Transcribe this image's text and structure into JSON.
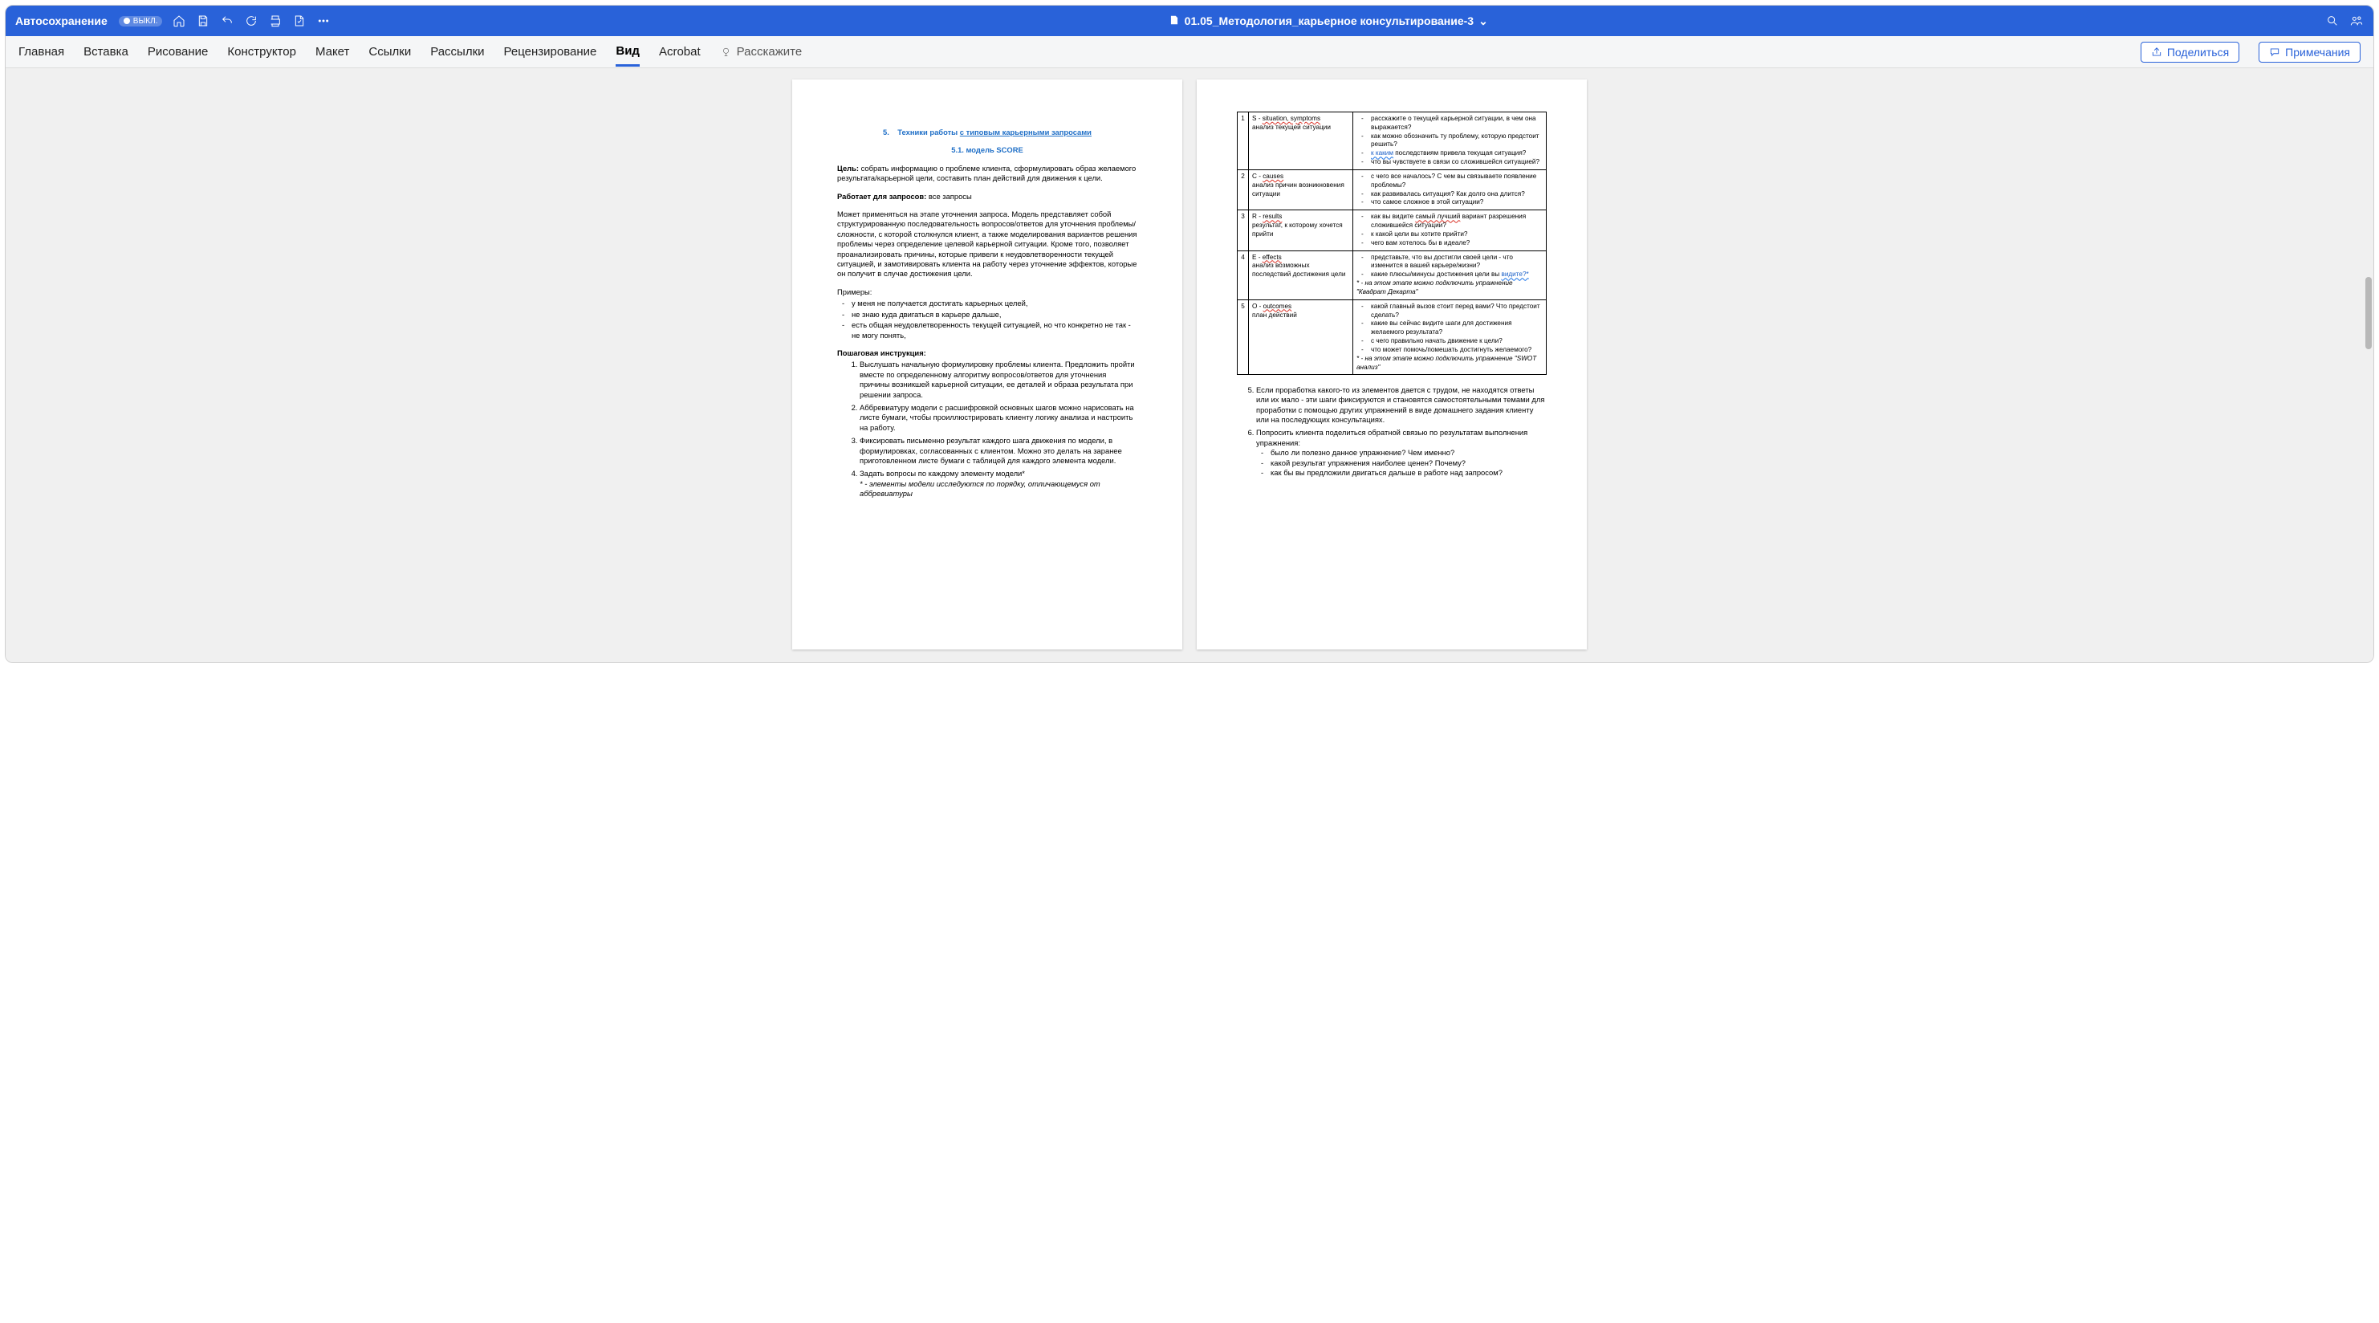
{
  "titlebar": {
    "autosave_label": "Автосохранение",
    "autosave_state": "ВЫКЛ.",
    "doc_title": "01.05_Методология_карьерное консультирование-3"
  },
  "ribbon": {
    "tabs": [
      "Главная",
      "Вставка",
      "Рисование",
      "Конструктор",
      "Макет",
      "Ссылки",
      "Рассылки",
      "Рецензирование",
      "Вид",
      "Acrobat"
    ],
    "tell_me": "Расскажите",
    "share": "Поделиться",
    "comments": "Примечания"
  },
  "p1": {
    "h_num": "5.",
    "h_title_plain": "Техники работы ",
    "h_title_link": "с типовым карьерными запросами",
    "h_sub": "5.1. модель SCORE",
    "goal_label": "Цель:",
    "goal_text": " собрать информацию о проблеме клиента, сформулировать образ желаемого результата/карьерной цели, составить план действий для движения к цели.",
    "works_label": "Работает для запросов:",
    "works_text": " все запросы",
    "desc": "Может применяться на этапе уточнения запроса. Модель представляет собой структурированную последовательность вопросов/ответов для уточнения проблемы/сложности, с которой столкнулся клиент, а также моделирования вариантов решения проблемы через определение целевой карьерной ситуации. Кроме того, позволяет проанализировать причины, которые привели к неудовлетворенности текущей ситуацией, и замотивировать клиента на работу через уточнение эффектов, которые он получит в случае достижения цели.",
    "examples_label": "Примеры:",
    "examples": [
      "у меня не получается достигать карьерных целей,",
      "не знаю куда двигаться в карьере дальше,",
      "есть общая неудовлетворенность текущей ситуацией, но что конкретно не так - не могу понять,"
    ],
    "steps_label": "Пошаговая инструкция:",
    "steps": [
      "Выслушать начальную формулировку проблемы клиента. Предложить пройти вместе по определенному алгоритму вопросов/ответов для уточнения причины возникшей карьерной ситуации, ее деталей и образа результата при решении запроса.",
      "Аббревиатуру модели с расшифровкой основных шагов можно нарисовать на листе бумаги, чтобы проиллюстрировать клиенту логику анализа и настроить на работу.",
      "Фиксировать письменно результат каждого шага движения по модели, в формулировках, согласованных с клиентом. Можно это делать на заранее приготовленном листе бумаги с таблицей для каждого элемента модели.",
      "Задать вопросы по каждому элементу модели*"
    ],
    "steps_note": "* - элементы модели исследуются по порядку, отличающемуся от аббревиатуры"
  },
  "p2": {
    "rows": [
      {
        "n": "1",
        "letter": "S - ",
        "word": "situation, symptoms",
        "sub": "анализ текущей ситуации",
        "qs": [
          "расскажите о текущей карьерной ситуации, в чем она выражается?",
          "как можно обозначить ту проблему, которую предстоит решить?",
          {
            "pre": "",
            "link": "к  каким",
            "post": " последствиям привела текущая ситуация?"
          },
          "что вы чувствуете в связи со сложившейся ситуацией?"
        ]
      },
      {
        "n": "2",
        "letter": "C - ",
        "word": "causes",
        "sub": "анализ причин возникновения ситуации",
        "qs": [
          "с чего все началось? С чем вы связываете появление проблемы?",
          "как развивалась ситуация? Как долго она длится?",
          "что самое сложное в этой ситуации?"
        ]
      },
      {
        "n": "3",
        "letter": "R - ",
        "word": "results",
        "sub": "результат, к которому хочется прийти",
        "qs": [
          {
            "pre": "как вы видите ",
            "und": "самый лучший",
            "post": " вариант разрешения сложившейся ситуации?"
          },
          "к какой цели вы хотите прийти?",
          "чего вам хотелось бы в идеале?"
        ]
      },
      {
        "n": "4",
        "letter": "E - ",
        "word": "effects",
        "sub": "анализ возможных последствий достижения цели",
        "qs": [
          "представьте, что вы достигли своей цели - что изменится в вашей карьере/жизни?",
          {
            "pre": "какие плюсы/минусы достижения цели вы ",
            "link": "видите?*",
            "post": ""
          }
        ],
        "note": "* - на этом этапе можно подключить упражнение \"Квадрат Декарта\""
      },
      {
        "n": "5",
        "letter": "O - ",
        "word": "outcomes",
        "sub": "план действий",
        "qs": [
          "какой главный вызов стоит перед вами? Что предстоит сделать?",
          "какие вы сейчас видите шаги для достижения желаемого результата?",
          "с чего правильно начать движение к цели?",
          "что может помочь/помешать достигнуть желаемого?"
        ],
        "note": "* - на этом этапе можно подключить упражнение \"SWOT анализ\""
      }
    ],
    "after_steps": [
      "Если проработка какого-то из элементов дается с трудом, не находятся ответы или их мало - эти шаги фиксируются и становятся самостоятельными темами для проработки с помощью других упражнений в виде домашнего задания клиенту или на последующих консультациях.",
      "Попросить клиента поделиться обратной связью по результатам выполнения упражнения:"
    ],
    "feedback": [
      "было ли полезно данное упражнение? Чем именно?",
      "какой результат упражнения наиболее ценен? Почему?",
      "как бы вы предложили двигаться дальше в работе над запросом?"
    ]
  }
}
